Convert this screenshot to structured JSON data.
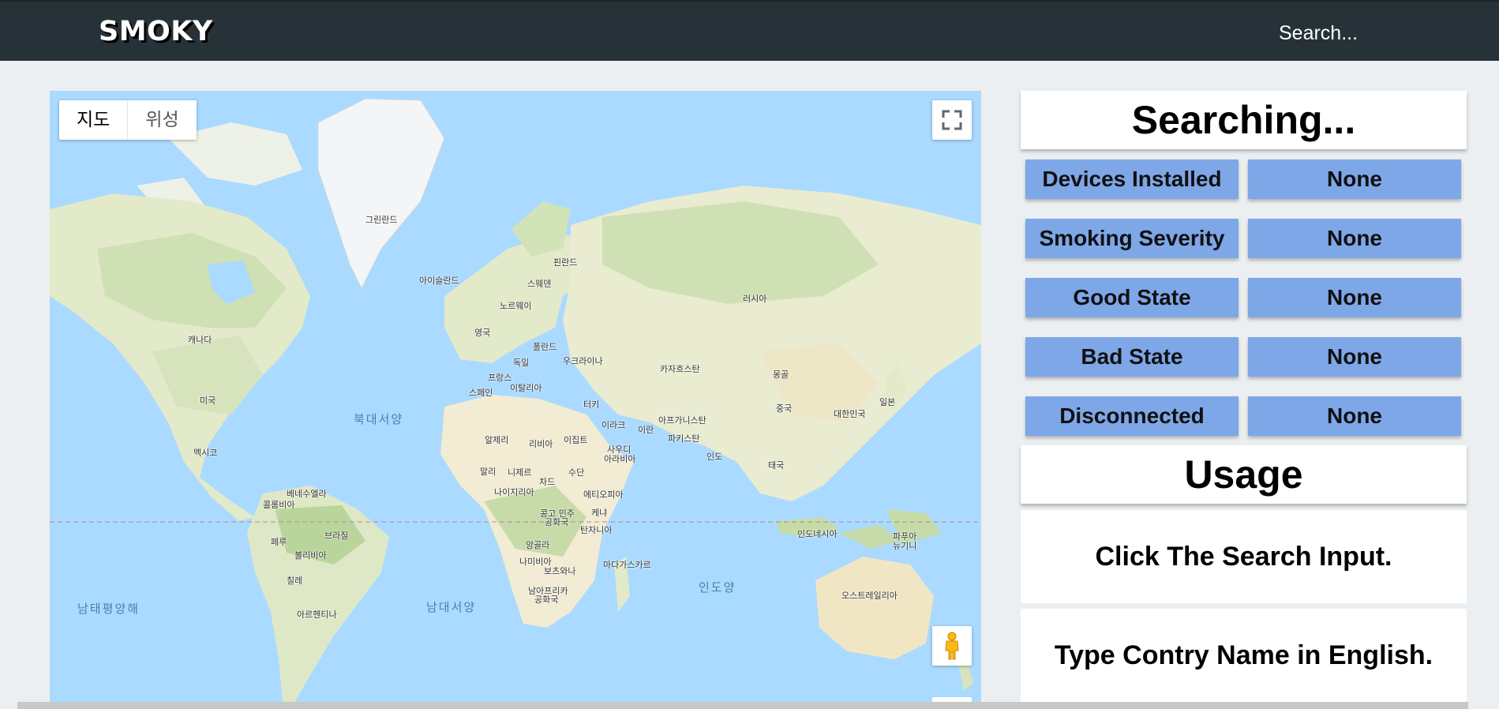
{
  "header": {
    "brand": "SMOKY",
    "search_placeholder": "Search..."
  },
  "map": {
    "map_type_options": [
      "지도",
      "위성"
    ],
    "active_map_type": "지도",
    "country_labels": {
      "greenland": "그린란드",
      "iceland": "아이슬란드",
      "finland": "핀란드",
      "sweden": "스웨덴",
      "norway": "노르웨이",
      "uk": "영국",
      "poland": "폴란드",
      "germany": "독일",
      "ukraine": "우크라이나",
      "france": "프랑스",
      "italy": "이탈리아",
      "spain": "스페인",
      "turkey": "터키",
      "russia": "러시아",
      "kazakhstan": "카자흐스탄",
      "mongolia": "몽골",
      "china": "중국",
      "korea": "대한민국",
      "japan": "일본",
      "canada": "캐나다",
      "usa": "미국",
      "mexico": "멕시코",
      "algeria": "알제리",
      "libya": "리비아",
      "egypt": "이집트",
      "iraq": "이라크",
      "iran": "이란",
      "afghanistan": "아프가니스탄",
      "pakistan": "파키스탄",
      "saudi1": "사우디",
      "saudi2": "아라비아",
      "india": "인도",
      "thailand": "태국",
      "mali": "말리",
      "niger": "니제르",
      "chad": "차드",
      "sudan": "수단",
      "nigeria": "나이지리아",
      "ethiopia": "에티오피아",
      "venezuela": "베네수엘라",
      "colombia": "콜롬비아",
      "drc1": "콩고 민주",
      "drc2": "공화국",
      "kenya": "케냐",
      "tanzania": "탄자니아",
      "peru": "페루",
      "brazil": "브라질",
      "bolivia": "볼리비아",
      "angola": "앙골라",
      "namibia": "나미비아",
      "botswana": "보츠와나",
      "madagascar": "마다가스카르",
      "chile": "칠레",
      "argentina": "아르헨티나",
      "southafrica1": "남아프리카",
      "southafrica2": "공화국",
      "indonesia": "인도네시아",
      "png1": "파푸아",
      "png2": "뉴기니",
      "australia": "오스트레일리아"
    },
    "ocean_labels": {
      "north_atlantic": "북대서양",
      "south_pacific": "남태평양해",
      "south_atlantic": "남대서양",
      "indian": "인도양"
    }
  },
  "panel": {
    "status_title": "Searching...",
    "stats": [
      {
        "label": "Devices Installed",
        "value": "None"
      },
      {
        "label": "Smoking Severity",
        "value": "None"
      },
      {
        "label": "Good State",
        "value": "None"
      },
      {
        "label": "Bad State",
        "value": "None"
      },
      {
        "label": "Disconnected",
        "value": "None"
      }
    ],
    "usage_title": "Usage",
    "usage_steps": [
      "Click The Search Input.",
      "Type Contry Name in English."
    ]
  },
  "colors": {
    "header_bg": "#263238",
    "page_bg": "#eceff1",
    "stat_bg": "#7ea7e8",
    "ocean": "#aadaff",
    "land": "#e8edd6"
  }
}
